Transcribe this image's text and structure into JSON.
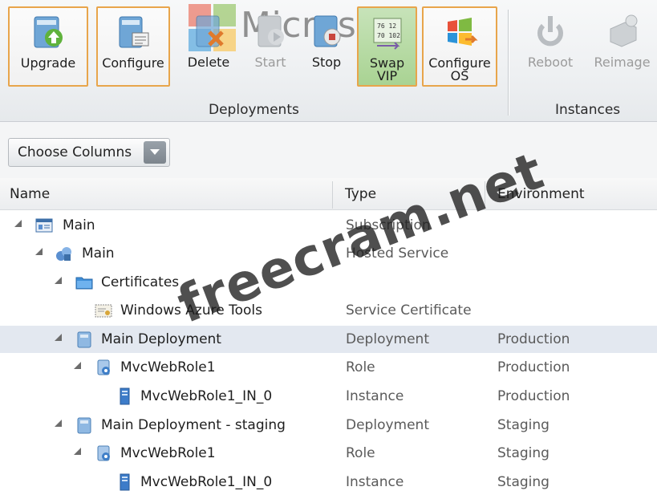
{
  "ribbon": {
    "buttons": [
      {
        "id": "upgrade",
        "label": "Upgrade",
        "icon": "upgrade-icon"
      },
      {
        "id": "configure",
        "label": "Configure",
        "icon": "configure-icon"
      },
      {
        "id": "delete",
        "label": "Delete",
        "icon": "delete-icon"
      },
      {
        "id": "start",
        "label": "Start",
        "icon": "start-icon"
      },
      {
        "id": "stop",
        "label": "Stop",
        "icon": "stop-icon"
      },
      {
        "id": "swap-vip",
        "label": "Swap\nVIP",
        "icon": "swap-vip-icon"
      },
      {
        "id": "configure-os",
        "label": "Configure\nOS",
        "icon": "configure-os-icon"
      },
      {
        "id": "reboot",
        "label": "Reboot",
        "icon": "reboot-icon"
      },
      {
        "id": "reimage",
        "label": "Reimage",
        "icon": "reimage-icon"
      }
    ],
    "groups": {
      "deployments": "Deployments",
      "instances": "Instances"
    }
  },
  "toolbar": {
    "choose_columns": "Choose Columns"
  },
  "columns": {
    "name": "Name",
    "type": "Type",
    "environment": "Environment"
  },
  "tree": [
    {
      "name": "Main",
      "type": "Subscription",
      "env": "",
      "icon": "subscription-icon"
    },
    {
      "name": "Main",
      "type": "Hosted Service",
      "env": "",
      "icon": "hosted-service-icon"
    },
    {
      "name": "Certificates",
      "type": "",
      "env": "",
      "icon": "folder-icon"
    },
    {
      "name": "Windows Azure Tools",
      "type": "Service Certificate",
      "env": "",
      "icon": "certificate-icon"
    },
    {
      "name": "Main Deployment",
      "type": "Deployment",
      "env": "Production",
      "icon": "deployment-icon"
    },
    {
      "name": "MvcWebRole1",
      "type": "Role",
      "env": "Production",
      "icon": "role-icon"
    },
    {
      "name": "MvcWebRole1_IN_0",
      "type": "Instance",
      "env": "Production",
      "icon": "instance-icon"
    },
    {
      "name": "Main Deployment - staging",
      "type": "Deployment",
      "env": "Staging",
      "icon": "deployment-icon"
    },
    {
      "name": "MvcWebRole1",
      "type": "Role",
      "env": "Staging",
      "icon": "role-icon"
    },
    {
      "name": "MvcWebRole1_IN_0",
      "type": "Instance",
      "env": "Staging",
      "icon": "instance-icon"
    }
  ],
  "watermark": {
    "site": "freecram.net",
    "brand": "Microsoft"
  },
  "colors": {
    "accent_border": "#e8a54b",
    "active_fill": "#a9d393",
    "selected_row": "#e3e8f0"
  }
}
